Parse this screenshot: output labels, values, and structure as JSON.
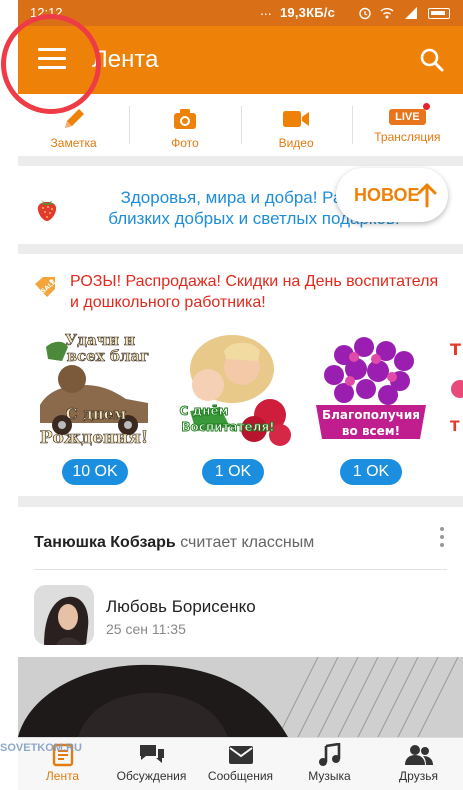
{
  "status_bar": {
    "time": "12:12",
    "network_speed": "19,3КБ/с",
    "more_indicator": "...",
    "icons": [
      "alarm-icon",
      "wifi-icon",
      "signal-icon",
      "battery-icon"
    ]
  },
  "app_bar": {
    "title": "Лента",
    "menu_icon": "hamburger-menu-icon",
    "search_icon": "search-icon"
  },
  "actions": [
    {
      "label": "Заметка",
      "icon": "pencil-icon"
    },
    {
      "label": "Фото",
      "icon": "camera-icon"
    },
    {
      "label": "Видео",
      "icon": "video-camera-icon"
    },
    {
      "label": "Трансляция",
      "icon": "live-icon",
      "badge": "LIVE"
    }
  ],
  "wish_card": {
    "text": "Здоровья, мира и добра! Радуйте близких добрых и светлых подарков!",
    "icon": "strawberry-icon"
  },
  "new_button": {
    "label": "НОВОЕ",
    "icon": "arrow-up-icon"
  },
  "promo": {
    "headline": "РОЗЫ! Распродажа! Скидки на День воспитателя и дошкольного работника!",
    "icon": "sale-tag-icon",
    "gifts": [
      {
        "caption_lines": [
          "Удачи и",
          "всех благ",
          "С днем",
          "Рождения!"
        ],
        "price": "10 OK"
      },
      {
        "caption_lines": [
          "С днём",
          "Воспитателя!"
        ],
        "price": "1 OK"
      },
      {
        "caption_lines": [
          "Благополучия",
          "во всем!"
        ],
        "price": "1 OK"
      }
    ]
  },
  "activity": {
    "actor": "Танюшка Кобзарь",
    "action": "считает классным",
    "author": "Любовь Борисенко",
    "date": "25 сен 11:35"
  },
  "bottom_nav": [
    {
      "label": "Лента",
      "icon": "feed-icon",
      "active": true
    },
    {
      "label": "Обсуждения",
      "icon": "discussions-icon",
      "active": false
    },
    {
      "label": "Сообщения",
      "icon": "messages-icon",
      "active": false
    },
    {
      "label": "Музыка",
      "icon": "music-icon",
      "active": false
    },
    {
      "label": "Друзья",
      "icon": "friends-icon",
      "active": false
    }
  ],
  "watermark": "SOVETKOM.RU",
  "colors": {
    "accent": "#ee8208",
    "status_bar": "#d97018",
    "link_blue": "#1e8ed8",
    "promo_red": "#e02a1e",
    "price_pill": "#1b8ee0",
    "annotation": "#ee3c46"
  }
}
